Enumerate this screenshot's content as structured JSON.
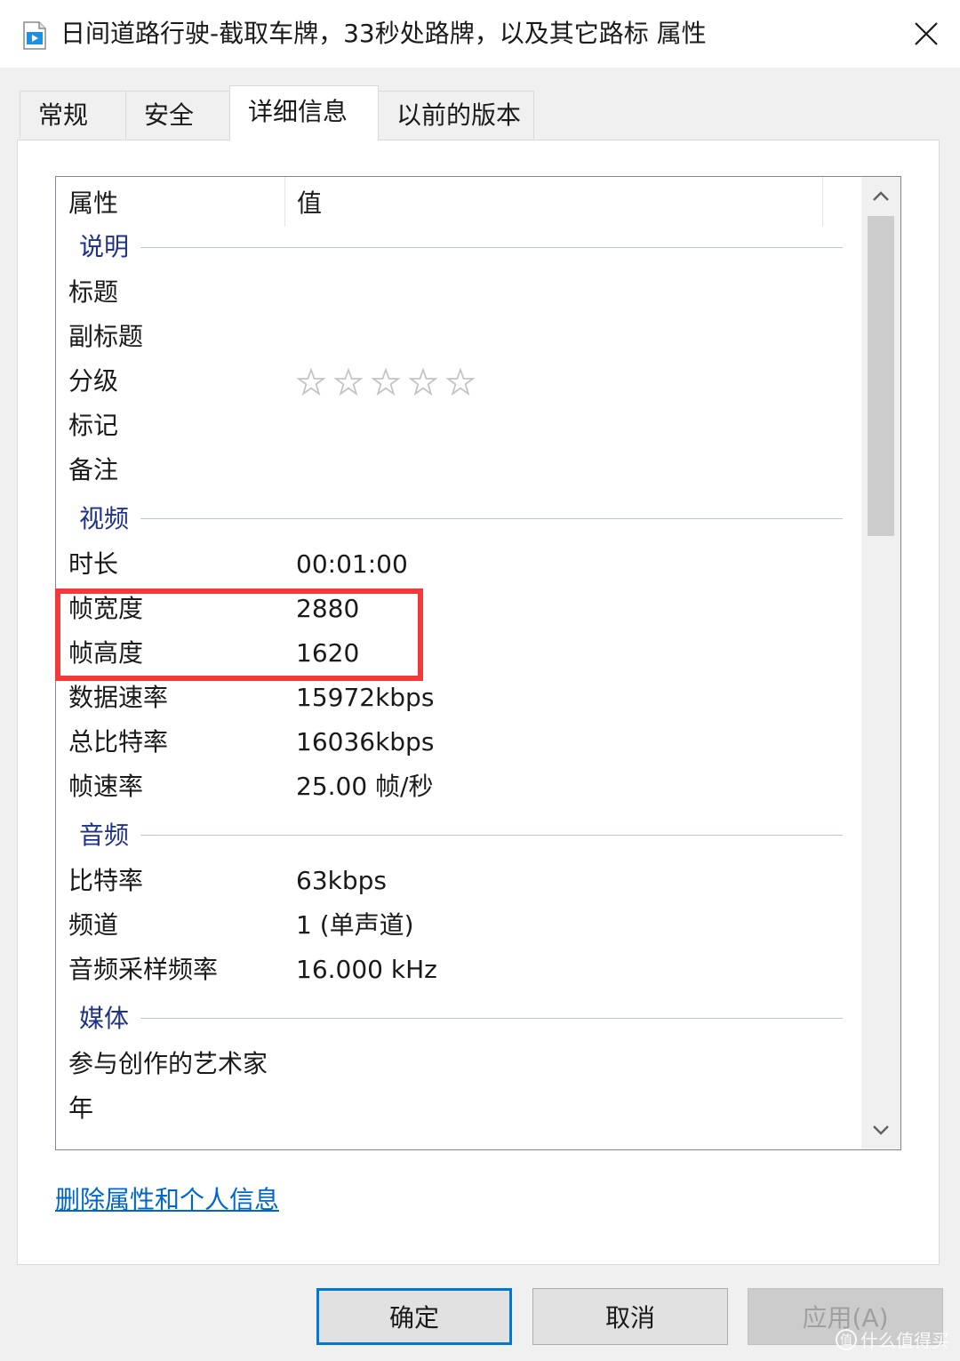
{
  "window": {
    "title": "日间道路行驶-截取车牌，33秒处路牌，以及其它路标 属性"
  },
  "tabs": [
    {
      "label": "常规"
    },
    {
      "label": "安全"
    },
    {
      "label": "详细信息"
    },
    {
      "label": "以前的版本"
    }
  ],
  "list": {
    "col_property": "属性",
    "col_value": "值",
    "groups": {
      "description": "说明",
      "video": "视频",
      "audio": "音频",
      "media": "媒体"
    },
    "rows": {
      "title": {
        "key": "标题",
        "value": ""
      },
      "subtitle": {
        "key": "副标题",
        "value": ""
      },
      "rating": {
        "key": "分级",
        "stars": 0,
        "max": 5
      },
      "tags": {
        "key": "标记",
        "value": ""
      },
      "comments": {
        "key": "备注",
        "value": ""
      },
      "length": {
        "key": "时长",
        "value": "00:01:00"
      },
      "frame_width": {
        "key": "帧宽度",
        "value": "2880"
      },
      "frame_height": {
        "key": "帧高度",
        "value": "1620"
      },
      "data_rate": {
        "key": "数据速率",
        "value": "15972kbps"
      },
      "total_bitrate": {
        "key": "总比特率",
        "value": "16036kbps"
      },
      "frame_rate": {
        "key": "帧速率",
        "value": "25.00 帧/秒"
      },
      "bitrate": {
        "key": "比特率",
        "value": "63kbps"
      },
      "channels": {
        "key": "频道",
        "value": "1 (单声道)"
      },
      "sample_rate": {
        "key": "音频采样频率",
        "value": "16.000 kHz"
      },
      "contributing_artists": {
        "key": "参与创作的艺术家",
        "value": ""
      },
      "year": {
        "key": "年",
        "value": ""
      }
    }
  },
  "link": {
    "remove_properties": "删除属性和个人信息"
  },
  "buttons": {
    "ok": "确定",
    "cancel": "取消",
    "apply": "应用(A)"
  },
  "watermark": {
    "text": "什么值得买",
    "glyph": "值"
  },
  "colors": {
    "highlight": "#f23a3a",
    "group_label": "#1e3287",
    "link": "#0066cc",
    "default_button_border": "#0078d7"
  }
}
